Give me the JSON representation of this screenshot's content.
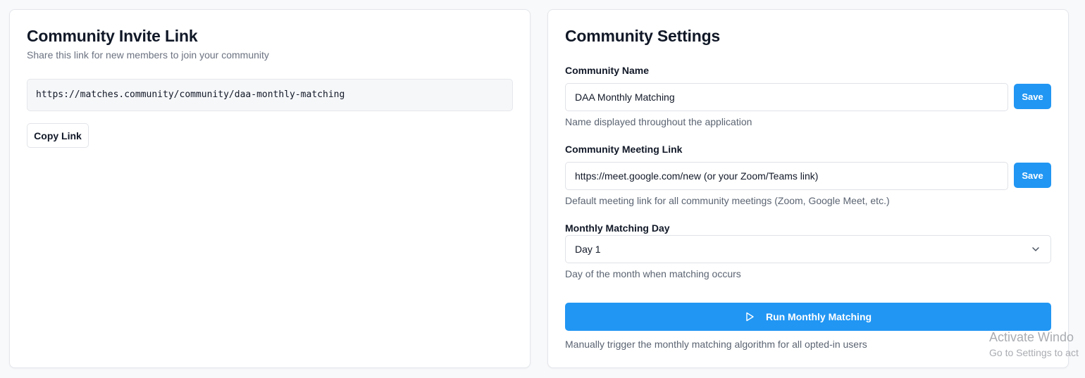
{
  "invite_card": {
    "title": "Community Invite Link",
    "description": "Share this link for new members to join your community",
    "invite_url": "https://matches.community/community/daa-monthly-matching",
    "copy_label": "Copy Link"
  },
  "settings_card": {
    "title": "Community Settings",
    "name_field": {
      "label": "Community Name",
      "value": "DAA Monthly Matching",
      "save_label": "Save",
      "help": "Name displayed throughout the application"
    },
    "meeting_field": {
      "label": "Community Meeting Link",
      "value": "https://meet.google.com/new (or your Zoom/Teams link)",
      "save_label": "Save",
      "help": "Default meeting link for all community meetings (Zoom, Google Meet, etc.)"
    },
    "matching_day_field": {
      "label": "Monthly Matching Day",
      "selected": "Day 1",
      "help": "Day of the month when matching occurs"
    },
    "run_matching": {
      "label": "Run Monthly Matching",
      "icon": "play-icon",
      "help": "Manually trigger the monthly matching algorithm for all opted-in users"
    }
  },
  "watermark": {
    "title": "Activate Windo",
    "subtitle": "Go to Settings to act"
  },
  "colors": {
    "accent": "#2196f3",
    "page_background": "#f8f9fb",
    "card_border": "#e3e6eb",
    "muted_text": "#6b7280"
  }
}
